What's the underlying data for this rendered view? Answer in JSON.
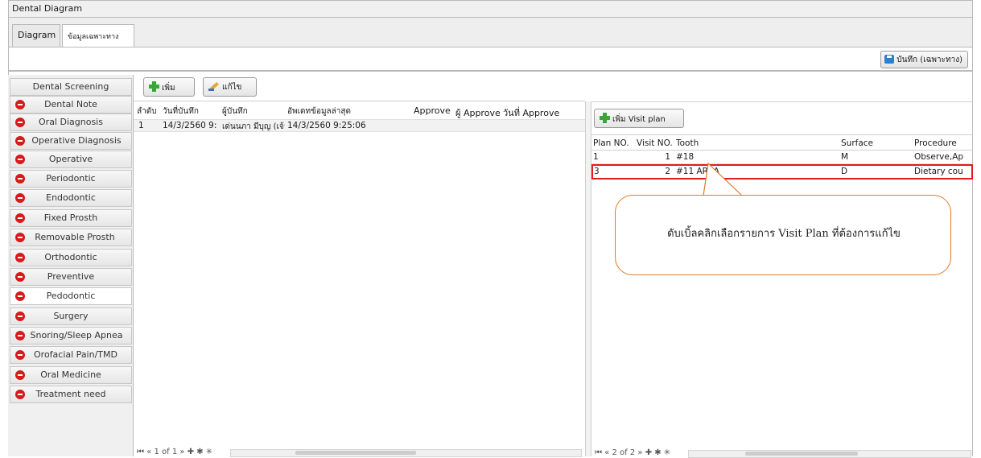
{
  "window": {
    "title": "Dental Diagram"
  },
  "tabs": [
    {
      "label": "Diagram"
    },
    {
      "label": "ข้อมูลเฉพาะทาง"
    }
  ],
  "toolbar": {
    "save_label": "บันทึก (เฉพาะทาง)"
  },
  "sidebar": {
    "items": [
      {
        "label": "Dental Screening"
      },
      {
        "label": "Dental Note"
      },
      {
        "label": "Oral Diagnosis"
      },
      {
        "label": "Operative Diagnosis"
      },
      {
        "label": "Operative"
      },
      {
        "label": "Periodontic"
      },
      {
        "label": "Endodontic"
      },
      {
        "label": "Fixed Prosth"
      },
      {
        "label": "Removable Prosth"
      },
      {
        "label": "Orthodontic"
      },
      {
        "label": "Preventive"
      },
      {
        "label": "Pedodontic"
      },
      {
        "label": "Surgery"
      },
      {
        "label": "Snoring/Sleep Apnea"
      },
      {
        "label": "Orofacial Pain/TMD"
      },
      {
        "label": "Oral Medicine"
      },
      {
        "label": "Treatment need"
      }
    ]
  },
  "left_panel": {
    "add_label": "เพิ่ม",
    "edit_label": "แก้ไข",
    "columns": [
      "ลำดับ",
      "วันที่บันทึก",
      "ผู้บันทึก",
      "อัพเดทข้อมูลล่าสุด",
      "Approve",
      "ผู้ Approve",
      "วันที่ Approve"
    ],
    "rows": [
      [
        "1",
        "14/3/2560 9:",
        "เด่นนภา มีบุญ (เจ้าหน้าที่ BMS",
        "14/3/2560 9:25:06",
        "",
        "",
        ""
      ]
    ],
    "nav": "1 of 1"
  },
  "right_panel": {
    "add_visit_label": "เพิ่ม Visit plan",
    "columns": [
      "Plan NO.",
      "Visit NO.",
      "Tooth",
      "Surface",
      "Procedure"
    ],
    "rows": [
      [
        "1",
        "1",
        "#18",
        "M",
        "Observe,Ap"
      ],
      [
        "3",
        "2",
        "#11 AREA",
        "D",
        "Dietary cou"
      ]
    ],
    "nav": "2 of 2"
  },
  "callout": {
    "text": "ดับเบิ้ลคลิกเลือกรายการ Visit Plan ที่ต้องการแก้ไข"
  },
  "colors": {
    "highlight": "#e21b1b",
    "callout_border": "#e07a2a",
    "minus_icon": "#d61b1b",
    "plus_icon": "#3aa63a"
  }
}
